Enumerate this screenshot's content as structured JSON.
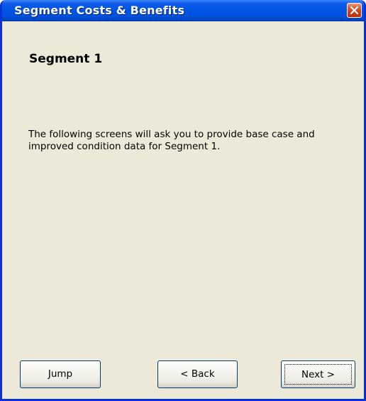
{
  "window": {
    "title": "Segment Costs & Benefits",
    "close_icon": "close-x-icon"
  },
  "content": {
    "heading": "Segment 1",
    "description": "The following screens will ask you to provide base case and improved condition data for Segment 1."
  },
  "buttons": {
    "jump_label": "Jump",
    "back_label": "< Back",
    "next_label": "Next >"
  },
  "colors": {
    "titlebar": "#0054e3",
    "window_bg": "#ece9d8",
    "close_button": "#c93b17"
  }
}
